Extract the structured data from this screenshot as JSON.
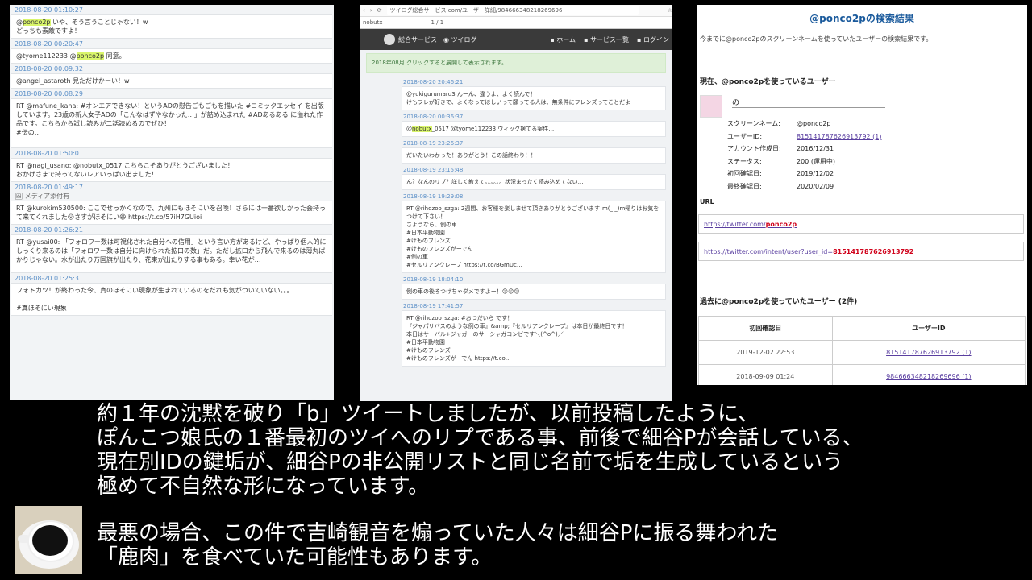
{
  "left_timeline": [
    {
      "date": "2018-08-20 01:10:27",
      "text": "@ponco2p いや、そう言うことじゃない！w\nどっちも素敵ですよ！",
      "hl": "ponco2p"
    },
    {
      "date": "2018-08-20 00:20:47",
      "text": "@tyome112233 @ponco2p 同意。",
      "hl": "ponco2p"
    },
    {
      "date": "2018-08-20 00:09:32",
      "text": "@angel_astaroth 見ただけかーい！w"
    },
    {
      "date": "2018-08-20 00:08:29",
      "text": "RT @mafune_kana: #オンエアできない！というADの慰告ごもごもを描いた #コミックエッセイ を出版しています。23歳の新人女子ADの「こんなはずやなかった…」が詰め込まれた #ADあるある に溢れた作品です。こちらから試し読みが二話読めるのでぜひ！\n#伝の…"
    },
    {
      "date": "2018-08-20 01:50:01",
      "text": "RT @nagi_usano: @nobutx_0517 こちらこそありがとうございました！\nおかげさまで持ってないレアいっぱい出ました！"
    },
    {
      "date": "2018-08-20 01:49:17",
      "meta": "メディア添付有",
      "text": "RT @kurokim530500: ここでせっかくなので、九州にもほそにいを召喚！さらには一番欲しかった会持って来てくれました😮さすがほそにい😆 https://t.co/57iH7GUioi"
    },
    {
      "date": "2018-08-20 01:26:21",
      "text": "RT @yusai00: 「フォロワー数は可視化された自分への信用」という言い方があるけど、やっぱり個人的にしっくり来るのは「フォロワー数は自分に向けられた拡口の数」だ。ただし拡口から飛んで来るのは薄丸ばかりじゃない。水が出たり万国旗が出たり、花束が出たりする事もある。幸い花が…"
    },
    {
      "date": "2018-08-20 01:25:31",
      "text": "フォトカツ！が終わった今、真のほそにい現象が生まれているのをだれも気がついていない。。。\n\n#真ほそにい現象"
    }
  ],
  "mid": {
    "address_url": "ツイログ総合サービス.com/ユーザー詳細/984666348218269696",
    "find_text": "nobutx",
    "find_count": "1 / 1",
    "brand": "総合サービス",
    "tab": "ツイログ",
    "nav_home": "ホーム",
    "nav_services": "サービス一覧",
    "nav_login": "ログイン",
    "notice": "2018年08月 クリックすると展開して表示されます。",
    "tweets": [
      {
        "date": "2018-08-20 20:46:21",
        "text": "@yukigurumaru3 んーん、違うよ、よく読んで！\nけもフレが好きで、よくなってほしいって願ってる人は、無条件にフレンズってことだよ"
      },
      {
        "date": "2018-08-20 00:36:37",
        "text": "@nobutx_0517 @tyome112233 ウィッグ捨てる案件…",
        "hl": "nobutx"
      },
      {
        "date": "2018-08-19 23:26:37",
        "text": "だいたいわかった！ありがとう！この話終わり！！"
      },
      {
        "date": "2018-08-19 23:15:48",
        "text": "ん？なんのリプ？詳しく教えて。。。。。。状況まったく読み込めてない…"
      },
      {
        "date": "2018-08-19 19:29:08",
        "text": "RT @rihdzoo_szga: 2週間、お客様を楽しませて頂きありがとうございます!m(_ _)m帰りはお気をつけて下さい！\nさようなら、例の車…\n#日本平動物園\n#けものフレンズ\n#けものフレンズがーでん\n#例の車\n#セルリアンクレープ https://t.co/BGmUc…"
      },
      {
        "date": "2018-08-19 18:04:10",
        "text": "例の車の後ろつけちゃダメですよー！😲😲😲"
      },
      {
        "date": "2018-08-19 17:41:57",
        "text": "RT @rihdzoo_szga: #おつだいら です！\n『ジャパリバスのような例の車』&amp;『セルリアンクレープ』は本日が最終日です！\n本日はサーバル+ジャガーのサーシャガコンビです＼(^o^)／\n#日本平動物園\n#けものフレンズ\n#けものフレンズがーでん https://t.co…"
      }
    ]
  },
  "right": {
    "title": "@ponco2pの検索結果",
    "desc": "今までに@ponco2pのスクリーンネームを使っていたユーザーの検索結果です。",
    "current_heading": "現在、@ponco2pを使っているユーザー",
    "display_name": "の",
    "props": [
      {
        "k": "スクリーンネーム:",
        "v": "@ponco2p"
      },
      {
        "k": "ユーザーID:",
        "v": "815141787626913792 (1)",
        "link": true
      },
      {
        "k": "アカウント作成日:",
        "v": "2016/12/31"
      },
      {
        "k": "ステータス:",
        "v": "200 (運用中)"
      },
      {
        "k": "初回確認日:",
        "v": "2019/12/02"
      },
      {
        "k": "最終確認日:",
        "v": "2020/02/09"
      }
    ],
    "url_label": "URL",
    "url1_prefix": "https://twitter.com/",
    "url1_name": "ponco2p",
    "url2_prefix": "https://twitter.com/intent/user?user_id=",
    "url2_id": "815141787626913792",
    "past_heading": "過去に@ponco2pを使っていたユーザー (2件)",
    "col_date": "初回確認日",
    "col_id": "ユーザーID",
    "rows": [
      {
        "date": "2019-12-02 22:53",
        "id": "815141787626913792 (1)"
      },
      {
        "date": "2018-09-09 01:24",
        "id": "984666348218269696 (1)"
      }
    ]
  },
  "subtitles": {
    "line1": "約１年の沈黙を破り「b」ツイートしましたが、以前投稿したように、",
    "line2": "ぽんこつ娘氏の１番最初のツイへのリプである事、前後で細谷Pが会話している、",
    "line3": "現在別IDの鍵垢が、細谷Pの非公開リストと同じ名前で垢を生成しているという",
    "line4": "極めて不自然な形になっています。",
    "line5": "最悪の場合、この件で吉崎観音を煽っていた人々は細谷Pに振る舞われた",
    "line6": "「鹿肉」を食べていた可能性もあります。"
  },
  "colors": {
    "date": "#5b8fc7",
    "highlight": "#d9f56b",
    "title": "#1a5a9c",
    "link": "#5a3fa0",
    "red": "#d0021b"
  }
}
